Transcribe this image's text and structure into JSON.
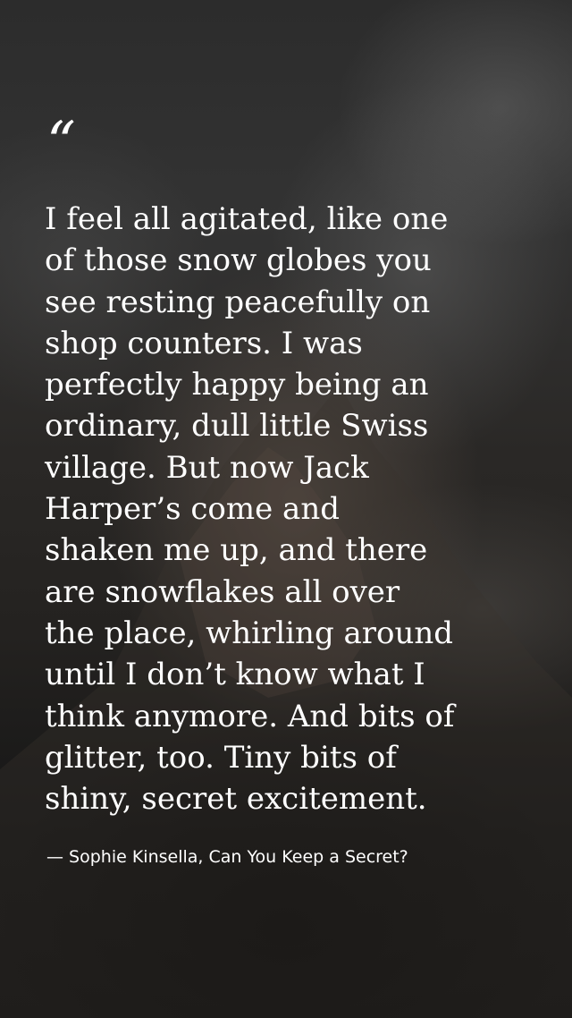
{
  "quote": {
    "mark": "“",
    "lines": [
      "I feel all agitated, like one",
      "of those snow globes you",
      "see resting peacefully on",
      "shop counters. I was",
      "perfectly happy being an",
      "ordinary, dull little Swiss",
      "village. But now Jack",
      "Harper’s come and",
      "shaken me up, and there",
      "are snowflakes all over",
      "the place, whirling around",
      "until I don’t know what I",
      "think anymore. And bits of",
      "glitter, too. Tiny bits of",
      "shiny, secret excitement."
    ],
    "attribution": "— Sophie Kinsella, Can You Keep a Secret?"
  },
  "colors": {
    "text": "#ffffff",
    "background": "#1a1a1a"
  }
}
